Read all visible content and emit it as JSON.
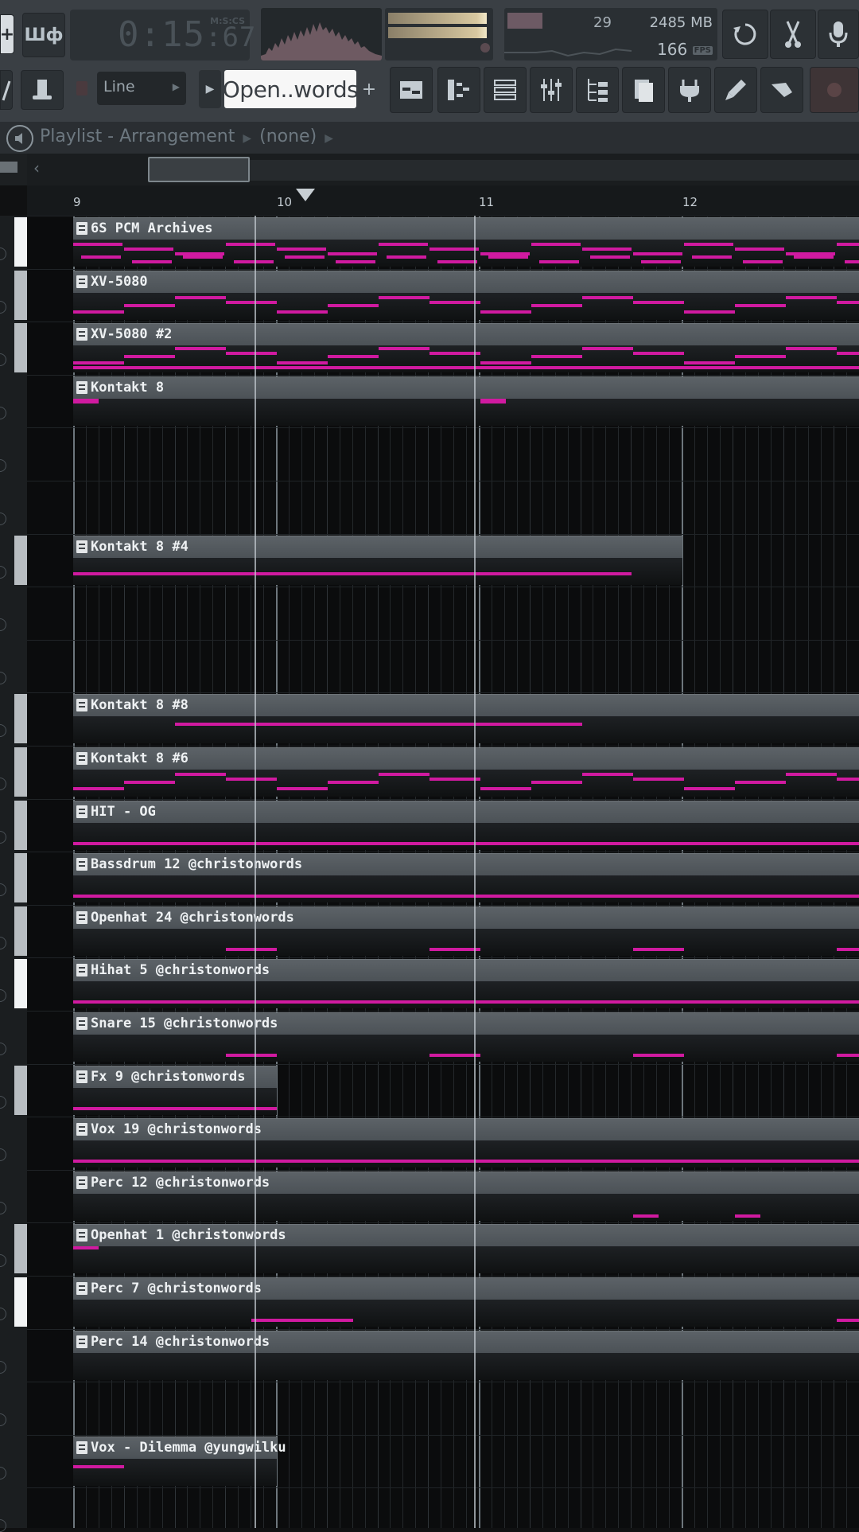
{
  "toolbar": {
    "add_label": "+",
    "snap_label": "Шф",
    "time": "0:15",
    "time_frac": ":67",
    "time_label": "M:S:CS",
    "cpu": "29",
    "memory": "2485 MB",
    "fps": "166",
    "fps_badge": "FPS",
    "snap_mode": "Line",
    "pattern_name": "Open..words",
    "pattern_add": "+",
    "accent": "#d01aa0"
  },
  "playlist": {
    "title": "Playlist - Arrangement",
    "arrangement": "(none)",
    "ruler": [
      "9",
      "10",
      "11",
      "12"
    ]
  },
  "clips": [
    {
      "name": "6S PCM Archives"
    },
    {
      "name": "XV-5080"
    },
    {
      "name": "XV-5080 #2"
    },
    {
      "name": "Kontakt 8"
    },
    {
      "name": "Kontakt 8 #4"
    },
    {
      "name": "Kontakt 8 #8"
    },
    {
      "name": "Kontakt 8 #6"
    },
    {
      "name": "HIT - OG"
    },
    {
      "name": "Bassdrum 12 @christonwords"
    },
    {
      "name": "Openhat 24 @christonwords"
    },
    {
      "name": "Hihat 5 @christonwords"
    },
    {
      "name": "Snare 15 @christonwords"
    },
    {
      "name": "Fx 9 @christonwords"
    },
    {
      "name": "Vox 19 @christonwords"
    },
    {
      "name": "Perc 12 @christonwords"
    },
    {
      "name": "Openhat 1 @christonwords"
    },
    {
      "name": "Perc 7 @christonwords"
    },
    {
      "name": "Perc 14 @christonwords"
    },
    {
      "name": "Vox - Dilemma @yungwilku"
    }
  ]
}
